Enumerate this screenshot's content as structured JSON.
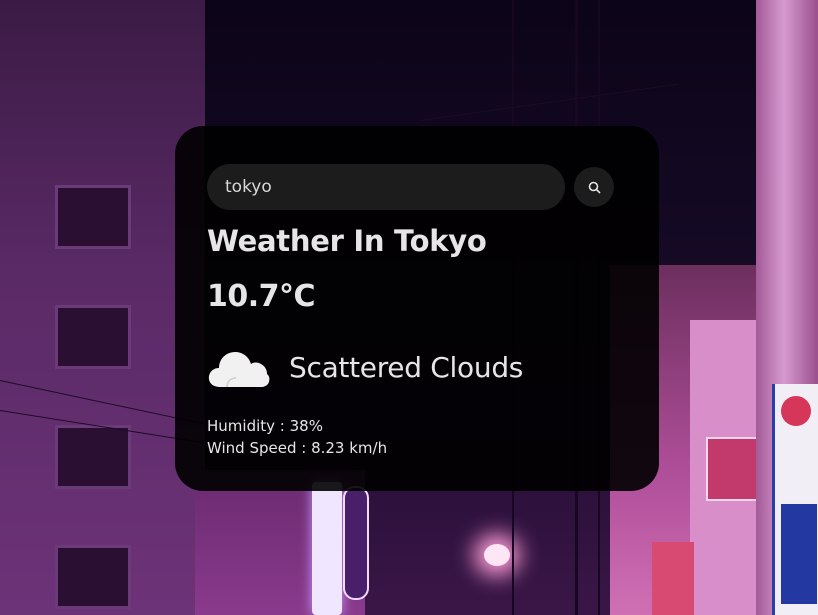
{
  "search": {
    "value": "tokyo",
    "icon": "search-icon"
  },
  "weather": {
    "city_title": "Weather In Tokyo",
    "temperature": "10.7°C",
    "condition_icon": "cloud-icon",
    "description": "Scattered Clouds",
    "humidity": "Humidity : 38%",
    "wind_speed": "Wind Speed : 8.23 km/h"
  },
  "colors": {
    "card_background": "#000000",
    "text": "#e6e6e6",
    "input_background": "#1c1c1c"
  }
}
